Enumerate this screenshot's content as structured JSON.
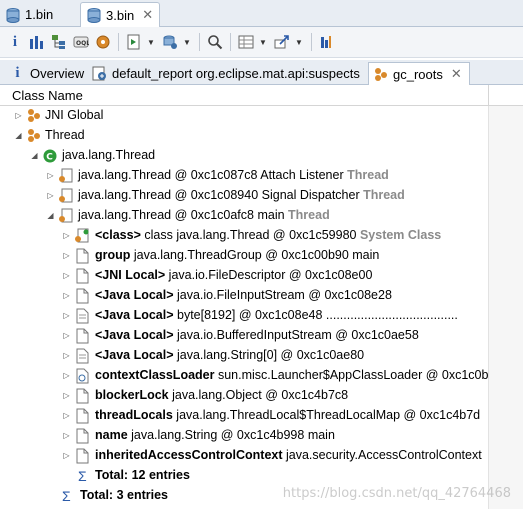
{
  "editor_tabs": [
    {
      "label": "1.bin",
      "active": false
    },
    {
      "label": "3.bin",
      "active": true,
      "close": "✕"
    }
  ],
  "view_tabs": [
    {
      "label": "Overview"
    },
    {
      "label": "default_report  org.eclipse.mat.api:suspects"
    },
    {
      "label": "gc_roots",
      "close": "✕"
    }
  ],
  "column_header": "Class Name",
  "tree": {
    "jni_global": "JNI Global",
    "thread_root": "Thread",
    "java_lang_thread": "java.lang.Thread",
    "thread1": {
      "text": "java.lang.Thread @ 0xc1c087c8  Attach Listener ",
      "suffix": "Thread"
    },
    "thread2": {
      "text": "java.lang.Thread @ 0xc1c08940  Signal Dispatcher ",
      "suffix": "Thread"
    },
    "thread3": {
      "text": "java.lang.Thread @ 0xc1c0afc8  main ",
      "suffix": "Thread"
    },
    "children": [
      {
        "bold": "<class>",
        "text": " class java.lang.Thread @ 0xc1c59980 ",
        "gray": "System Class"
      },
      {
        "bold": "group",
        "text": " java.lang.ThreadGroup @ 0xc1c00b90  main"
      },
      {
        "bold": "<JNI Local>",
        "text": " java.io.FileDescriptor @ 0xc1c08e00"
      },
      {
        "bold": "<Java Local>",
        "text": " java.io.FileInputStream @ 0xc1c08e28"
      },
      {
        "bold": "<Java Local>",
        "text": " byte[8192] @ 0xc1c08e48  ......................................"
      },
      {
        "bold": "<Java Local>",
        "text": " java.io.BufferedInputStream @ 0xc1c0ae58"
      },
      {
        "bold": "<Java Local>",
        "text": " java.lang.String[0] @ 0xc1c0ae80"
      },
      {
        "bold": "contextClassLoader",
        "text": " sun.misc.Launcher$AppClassLoader @ 0xc1c0b"
      },
      {
        "bold": "blockerLock",
        "text": " java.lang.Object @ 0xc1c4b7c8"
      },
      {
        "bold": "threadLocals",
        "text": " java.lang.ThreadLocal$ThreadLocalMap @ 0xc1c4b7d"
      },
      {
        "bold": "name",
        "text": " java.lang.String @ 0xc1c4b998  main"
      },
      {
        "bold": "inheritedAccessControlContext",
        "text": " java.security.AccessControlContext"
      }
    ],
    "total_inner": "Total: 12 entries",
    "total_outer": "Total: 3 entries",
    "sigma": "Σ"
  },
  "watermark": "https://blog.csdn.net/qq_42764468",
  "colors": {
    "accent": "#2b5aa8",
    "gray_suffix": "#8a8a8a",
    "class_green": "#2e9b3a",
    "object_orange": "#d9892b"
  }
}
